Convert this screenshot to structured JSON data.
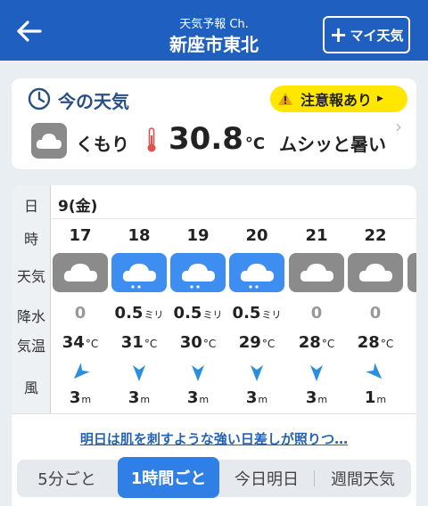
{
  "header": {
    "subtitle": "天気予報 Ch.",
    "title": "新座市東北",
    "my_weather_label": "マイ天気"
  },
  "now": {
    "title": "今の天気",
    "alert_label": "注意報あり",
    "condition": "くもり",
    "temperature": "30.8",
    "temperature_unit": "°C",
    "feel": "ムシッと暑い"
  },
  "forecast": {
    "row_labels": {
      "date": "日",
      "hour": "時",
      "weather": "天気",
      "precip": "降水",
      "temp": "気温",
      "wind": "風"
    },
    "date": "9(金)",
    "precip_unit": "ミリ",
    "temp_unit": "°C",
    "wind_unit": "m",
    "hours": [
      {
        "hour": "17",
        "weather": "cloudy-icon",
        "precip": "0",
        "temp": "34",
        "wind_dir": "northeast",
        "wind_speed": "3"
      },
      {
        "hour": "18",
        "weather": "rain-icon",
        "precip": "0.5",
        "temp": "31",
        "wind_dir": "north",
        "wind_speed": "3"
      },
      {
        "hour": "19",
        "weather": "rain-icon",
        "precip": "0.5",
        "temp": "30",
        "wind_dir": "north",
        "wind_speed": "3"
      },
      {
        "hour": "20",
        "weather": "rain-icon",
        "precip": "0.5",
        "temp": "29",
        "wind_dir": "north",
        "wind_speed": "3"
      },
      {
        "hour": "21",
        "weather": "cloudy-icon",
        "precip": "0",
        "temp": "28",
        "wind_dir": "north",
        "wind_speed": "3"
      },
      {
        "hour": "22",
        "weather": "cloudy-icon",
        "precip": "0",
        "temp": "28",
        "wind_dir": "northwest",
        "wind_speed": "1"
      }
    ],
    "summary": "明日は肌を刺すような強い日差しが照りつ…"
  },
  "tabs": [
    {
      "label": "5分ごと",
      "active": false
    },
    {
      "label": "1時間ごと",
      "active": true
    },
    {
      "label": "今日明日",
      "active": false
    },
    {
      "label": "週間天気",
      "active": false
    }
  ],
  "colors": {
    "header_bg": "#1f5fbf",
    "alert_bg": "#ffe700",
    "rain_icon_bg": "#3d8ef0",
    "cloud_icon_bg": "#8b8b8b",
    "wind_arrow": "#2a8fe0",
    "active_tab": "#2f7fe6"
  }
}
